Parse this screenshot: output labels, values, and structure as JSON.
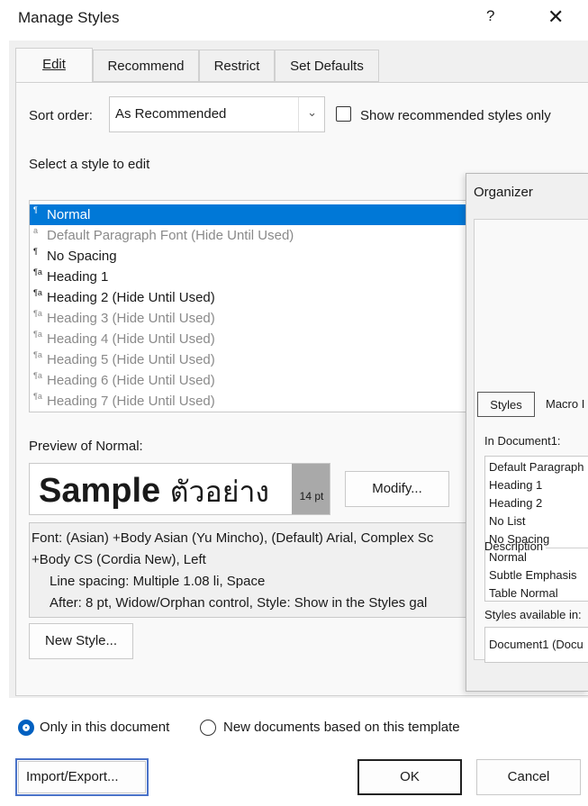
{
  "window": {
    "title": "Manage Styles",
    "help": "?",
    "close": "✕"
  },
  "tabs": [
    {
      "label": "Edit",
      "active": true
    },
    {
      "label": "Recommend",
      "active": false
    },
    {
      "label": "Restrict",
      "active": false
    },
    {
      "label": "Set Defaults",
      "active": false
    }
  ],
  "sort": {
    "label": "Sort order:",
    "value": "As Recommended",
    "checkbox_label": "Show recommended styles only",
    "checked": false
  },
  "style_list": {
    "label": "Select a style to edit",
    "items": [
      {
        "icon": "¶",
        "text": "Normal",
        "selected": true,
        "gray": false
      },
      {
        "icon": "a",
        "text": "Default Paragraph Font  (Hide Until Used)",
        "selected": false,
        "gray": true
      },
      {
        "icon": "¶",
        "text": "No Spacing",
        "selected": false,
        "gray": false
      },
      {
        "icon": "¶a",
        "text": "Heading 1",
        "selected": false,
        "gray": false
      },
      {
        "icon": "¶a",
        "text": "Heading 2  (Hide Until Used)",
        "selected": false,
        "gray": false
      },
      {
        "icon": "¶a",
        "text": "Heading 3  (Hide Until Used)",
        "selected": false,
        "gray": true
      },
      {
        "icon": "¶a",
        "text": "Heading 4  (Hide Until Used)",
        "selected": false,
        "gray": true
      },
      {
        "icon": "¶a",
        "text": "Heading 5  (Hide Until Used)",
        "selected": false,
        "gray": true
      },
      {
        "icon": "¶a",
        "text": "Heading 6  (Hide Until Used)",
        "selected": false,
        "gray": true
      },
      {
        "icon": "¶a",
        "text": "Heading 7  (Hide Until Used)",
        "selected": false,
        "gray": true
      }
    ]
  },
  "preview": {
    "label": "Preview of Normal:",
    "sample": "Sample",
    "sample_thai": "ตัวอย่าง",
    "size": "14 pt",
    "modify_label": "Modify..."
  },
  "description": {
    "line1": "Font: (Asian) +Body Asian (Yu Mincho), (Default) Arial, Complex Sc",
    "line2": "+Body CS (Cordia New), Left",
    "line3": "Line spacing:  Multiple 1.08 li, Space",
    "line4": "After:  8 pt, Widow/Orphan control, Style: Show in the Styles gal"
  },
  "new_style_label": "New Style...",
  "scope": {
    "option1": "Only in this document",
    "option2": "New documents based on this template",
    "selected": "option1"
  },
  "footer": {
    "import_export": "Import/Export...",
    "ok": "OK",
    "cancel": "Cancel"
  },
  "organizer": {
    "title": "Organizer",
    "tab_styles": "Styles",
    "tab_macro": "Macro I",
    "in_document_label": "In Document1:",
    "items": [
      "Default Paragraph",
      "Heading 1",
      "Heading 2",
      "No List",
      "No Spacing",
      "Normal",
      "Subtle Emphasis",
      "Table Normal"
    ],
    "available_label": "Styles available in:",
    "available_value": "Document1 (Docu",
    "description_label": "Description"
  },
  "colors": {
    "accent": "#0078d7",
    "focus_outline": "#2f5fbf",
    "dialog_bg": "#f0f0f0"
  }
}
